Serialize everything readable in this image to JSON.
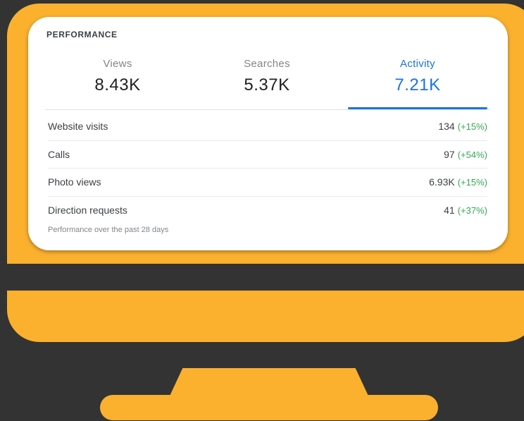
{
  "card": {
    "title": "PERFORMANCE",
    "footer": "Performance over the past 28 days"
  },
  "tabs": [
    {
      "label": "Views",
      "value": "8.43K",
      "active": false
    },
    {
      "label": "Searches",
      "value": "5.37K",
      "active": false
    },
    {
      "label": "Activity",
      "value": "7.21K",
      "active": true
    }
  ],
  "metrics": [
    {
      "label": "Website visits",
      "value": "134",
      "change": "(+15%)"
    },
    {
      "label": "Calls",
      "value": "97",
      "change": "(+54%)"
    },
    {
      "label": "Photo views",
      "value": "6.93K",
      "change": "(+15%)"
    },
    {
      "label": "Direction requests",
      "value": "41",
      "change": "(+37%)"
    }
  ],
  "colors": {
    "monitor": "#FBB12E",
    "background": "#333333",
    "accent": "#1A73E8",
    "positive_change": "#34A853"
  }
}
